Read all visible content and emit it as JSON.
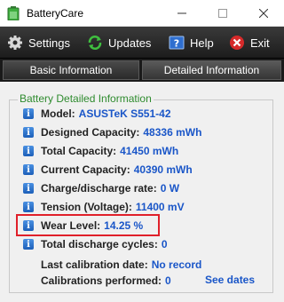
{
  "window": {
    "title": "BatteryCare"
  },
  "toolbar": {
    "settings_label": "Settings",
    "updates_label": "Updates",
    "help_label": "Help",
    "exit_label": "Exit"
  },
  "tabs": [
    {
      "label": "Basic Information"
    },
    {
      "label": "Detailed Information"
    }
  ],
  "details": {
    "group_title": "Battery Detailed Information",
    "model": {
      "label": "Model:",
      "value": "ASUSTeK S551-42"
    },
    "designed_capacity": {
      "label": "Designed Capacity:",
      "value": "48336 mWh"
    },
    "total_capacity": {
      "label": "Total Capacity:",
      "value": "41450 mWh"
    },
    "current_capacity": {
      "label": "Current Capacity:",
      "value": "40390 mWh"
    },
    "charge_rate": {
      "label": "Charge/discharge rate:",
      "value": "0 W"
    },
    "tension": {
      "label": "Tension (Voltage):",
      "value": "11400 mV"
    },
    "wear_level": {
      "label": "Wear Level:",
      "value": "14.25 %"
    },
    "discharge_cycles": {
      "label": "Total discharge cycles:",
      "value": "0"
    },
    "last_calibration": {
      "label": "Last calibration date:",
      "value": "No record"
    },
    "calibrations": {
      "label": "Calibrations performed:",
      "value": "0"
    },
    "see_dates_label": "See dates"
  },
  "colors": {
    "accent_blue": "#1a56c8",
    "group_title_green": "#2e8b2e",
    "highlight_red": "#e0202a"
  }
}
